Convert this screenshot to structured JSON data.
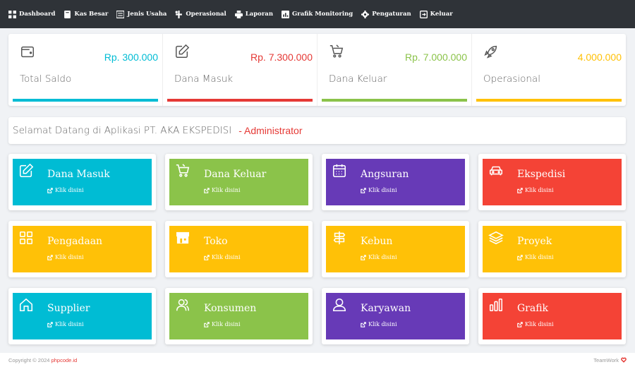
{
  "nav": [
    {
      "label": "Dashboard",
      "icon": "dashboard-icon"
    },
    {
      "label": "Kas Besar",
      "icon": "book-icon"
    },
    {
      "label": "Jenis Usaha",
      "icon": "list-icon"
    },
    {
      "label": "Operasional",
      "icon": "tools-icon"
    },
    {
      "label": "Laporan",
      "icon": "print-icon"
    },
    {
      "label": "Grafik Monitoring",
      "icon": "chart-icon"
    },
    {
      "label": "Pengaturan",
      "icon": "gear-icon"
    },
    {
      "label": "Keluar",
      "icon": "logout-icon"
    }
  ],
  "stats": [
    {
      "label": "Total Saldo",
      "value": "Rp. 300.000",
      "color": "#00bcd4",
      "icon": "wallet-icon"
    },
    {
      "label": "Dana Masuk",
      "value": "Rp. 7.300.000",
      "color": "#e53935",
      "icon": "edit-icon"
    },
    {
      "label": "Dana Keluar",
      "value": "Rp. 7.000.000",
      "color": "#8bc34a",
      "icon": "cart-icon"
    },
    {
      "label": "Operasional",
      "value": "4.000.000",
      "color": "#ffc107",
      "icon": "rocket-icon"
    }
  ],
  "welcome": {
    "text": "Selamat Datang di Aplikasi PT. AKA EKSPEDISI",
    "role": "- Administrator"
  },
  "cards": [
    {
      "title": "Dana Masuk",
      "link": "Klik disini",
      "color": "#00bcd4",
      "icon": "edit-icon"
    },
    {
      "title": "Dana Keluar",
      "link": "Klik disini",
      "color": "#8bc34a",
      "icon": "cart-icon"
    },
    {
      "title": "Angsuran",
      "link": "Klik disini",
      "color": "#673ab7",
      "icon": "calendar-icon"
    },
    {
      "title": "Ekspedisi",
      "link": "Klik disini",
      "color": "#f44336",
      "icon": "car-icon"
    },
    {
      "title": "Pengadaan",
      "link": "Klik disini",
      "color": "#ffc107",
      "icon": "grid-icon"
    },
    {
      "title": "Toko",
      "link": "Klik disini",
      "color": "#ffc107",
      "icon": "store-icon"
    },
    {
      "title": "Kebun",
      "link": "Klik disini",
      "color": "#ffc107",
      "icon": "signpost-icon"
    },
    {
      "title": "Proyek",
      "link": "Klik disini",
      "color": "#ffc107",
      "icon": "layers-icon"
    },
    {
      "title": "Supplier",
      "link": "Klik disini",
      "color": "#00bcd4",
      "icon": "home-icon"
    },
    {
      "title": "Konsumen",
      "link": "Klik disini",
      "color": "#8bc34a",
      "icon": "users-icon"
    },
    {
      "title": "Karyawan",
      "link": "Klik disini",
      "color": "#673ab7",
      "icon": "user-icon"
    },
    {
      "title": "Grafik",
      "link": "Klik disini",
      "color": "#f44336",
      "icon": "bar-chart-icon"
    }
  ],
  "footer": {
    "copyright": "Copyright © 2024",
    "brand": "phpcode.id",
    "right": "TeamWork"
  }
}
